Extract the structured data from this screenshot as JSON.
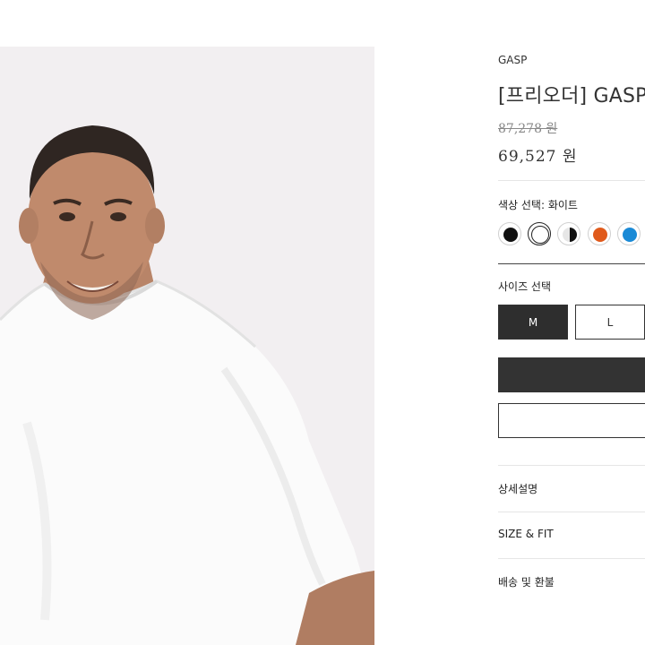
{
  "product": {
    "brand": "GASP",
    "title": "[프리오더] GASP 오",
    "original_price": "87,278 원",
    "sale_price": "69,527 원"
  },
  "color_selector": {
    "label": "색상 선택: 화이트",
    "options": [
      {
        "name": "black",
        "color": "#111111",
        "selected": false
      },
      {
        "name": "white",
        "color": "#ffffff",
        "selected": true
      },
      {
        "name": "black-white",
        "color": "#222222",
        "selected": false
      },
      {
        "name": "orange",
        "color": "#e05a1b",
        "selected": false
      },
      {
        "name": "blue",
        "color": "#1a8ad6",
        "selected": false
      }
    ]
  },
  "size_selector": {
    "label": "사이즈 선택",
    "options": [
      {
        "label": "M",
        "selected": true
      },
      {
        "label": "L",
        "selected": false
      }
    ]
  },
  "accordion": {
    "details": "상세설명",
    "size_fit": "SIZE & FIT",
    "shipping": "배송 및 환불"
  },
  "colors": {
    "primary_button": "#333333",
    "photo_background": "#f2eff1"
  }
}
